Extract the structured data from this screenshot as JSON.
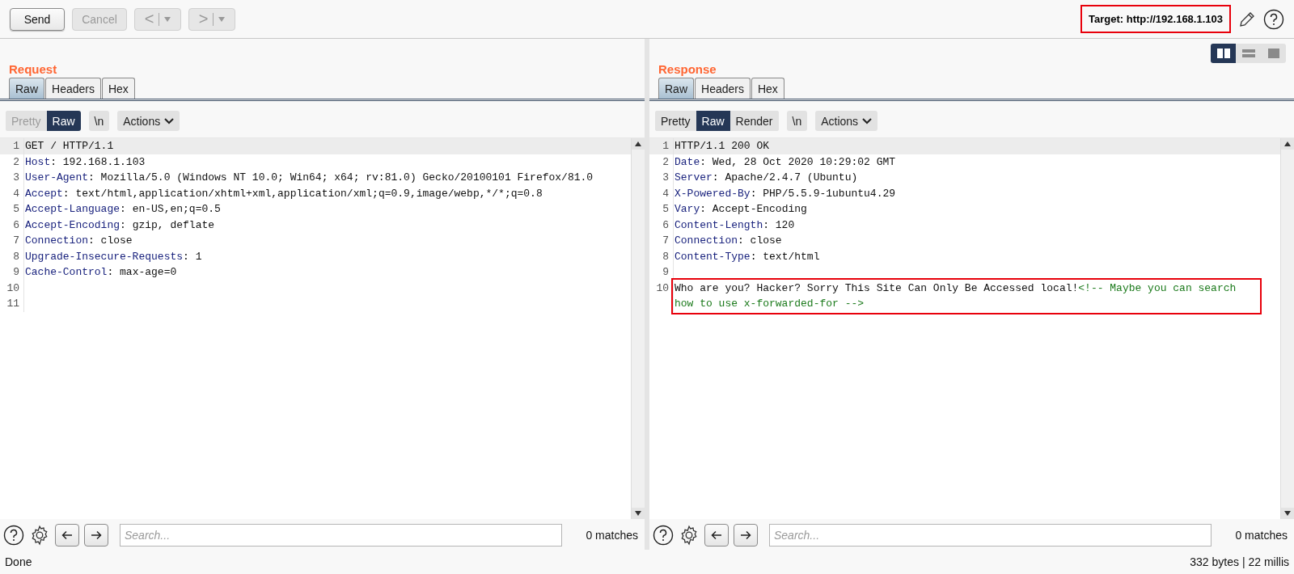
{
  "toolbar": {
    "buttons": [
      {
        "kind": "text",
        "label": "Send",
        "disabled": false
      },
      {
        "kind": "text",
        "label": "Cancel",
        "disabled": true
      },
      {
        "kind": "back",
        "label": "<",
        "disabled": true
      },
      {
        "kind": "forward",
        "label": ">",
        "disabled": true
      }
    ],
    "target": {
      "label": "Target: http://192.168.1.103",
      "outlined": true
    }
  },
  "view_modes": [
    {
      "kind": "split",
      "selected": true
    },
    {
      "kind": "stacked",
      "selected": false
    },
    {
      "kind": "single",
      "selected": false
    }
  ],
  "panes": [
    {
      "title": "Request",
      "tabs": [
        {
          "label": "Raw",
          "selected": true
        },
        {
          "label": "Headers",
          "selected": false
        },
        {
          "label": "Hex",
          "selected": false
        }
      ],
      "formats": [
        {
          "label": "Pretty",
          "selected": false,
          "disabled": true
        },
        {
          "label": "Raw",
          "selected": true,
          "disabled": false
        }
      ],
      "newline": "\\n",
      "actions": "Actions",
      "lines": [
        {
          "number": "1",
          "current": true,
          "outlined": false,
          "segments": [
            {
              "kind": "plain",
              "text": "GET / HTTP/1.1"
            }
          ]
        },
        {
          "number": "2",
          "current": false,
          "outlined": false,
          "segments": [
            {
              "kind": "name",
              "text": "Host"
            },
            {
              "kind": "plain",
              "text": ": 192.168.1.103"
            }
          ]
        },
        {
          "number": "3",
          "current": false,
          "outlined": false,
          "segments": [
            {
              "kind": "name",
              "text": "User-Agent"
            },
            {
              "kind": "plain",
              "text": ": Mozilla/5.0 (Windows NT 10.0; Win64; x64; rv:81.0) Gecko/20100101 Firefox/81.0"
            }
          ]
        },
        {
          "number": "4",
          "current": false,
          "outlined": false,
          "segments": [
            {
              "kind": "name",
              "text": "Accept"
            },
            {
              "kind": "plain",
              "text": ": text/html,application/xhtml+xml,application/xml;q=0.9,image/webp,*/*;q=0.8"
            }
          ]
        },
        {
          "number": "5",
          "current": false,
          "outlined": false,
          "segments": [
            {
              "kind": "name",
              "text": "Accept-Language"
            },
            {
              "kind": "plain",
              "text": ": en-US,en;q=0.5"
            }
          ]
        },
        {
          "number": "6",
          "current": false,
          "outlined": false,
          "segments": [
            {
              "kind": "name",
              "text": "Accept-Encoding"
            },
            {
              "kind": "plain",
              "text": ": gzip, deflate"
            }
          ]
        },
        {
          "number": "7",
          "current": false,
          "outlined": false,
          "segments": [
            {
              "kind": "name",
              "text": "Connection"
            },
            {
              "kind": "plain",
              "text": ": close"
            }
          ]
        },
        {
          "number": "8",
          "current": false,
          "outlined": false,
          "segments": [
            {
              "kind": "name",
              "text": "Upgrade-Insecure-Requests"
            },
            {
              "kind": "plain",
              "text": ": 1"
            }
          ]
        },
        {
          "number": "9",
          "current": false,
          "outlined": false,
          "segments": [
            {
              "kind": "name",
              "text": "Cache-Control"
            },
            {
              "kind": "plain",
              "text": ": max-age=0"
            }
          ]
        },
        {
          "number": "10",
          "current": false,
          "outlined": false
        },
        {
          "number": "11",
          "current": false,
          "outlined": false
        }
      ],
      "search": {
        "placeholder": "Search...",
        "matches": "0 matches"
      }
    },
    {
      "title": "Response",
      "tabs": [
        {
          "label": "Raw",
          "selected": true
        },
        {
          "label": "Headers",
          "selected": false
        },
        {
          "label": "Hex",
          "selected": false
        }
      ],
      "formats": [
        {
          "label": "Pretty",
          "selected": false,
          "disabled": false
        },
        {
          "label": "Raw",
          "selected": true,
          "disabled": false
        },
        {
          "label": "Render",
          "selected": false,
          "disabled": false
        }
      ],
      "newline": "\\n",
      "actions": "Actions",
      "lines": [
        {
          "number": "1",
          "current": true,
          "outlined": false,
          "segments": [
            {
              "kind": "plain",
              "text": "HTTP/1.1 200 OK"
            }
          ]
        },
        {
          "number": "2",
          "current": false,
          "outlined": false,
          "segments": [
            {
              "kind": "name",
              "text": "Date"
            },
            {
              "kind": "plain",
              "text": ": Wed, 28 Oct 2020 10:29:02 GMT"
            }
          ]
        },
        {
          "number": "3",
          "current": false,
          "outlined": false,
          "segments": [
            {
              "kind": "name",
              "text": "Server"
            },
            {
              "kind": "plain",
              "text": ": Apache/2.4.7 (Ubuntu)"
            }
          ]
        },
        {
          "number": "4",
          "current": false,
          "outlined": false,
          "segments": [
            {
              "kind": "name",
              "text": "X-Powered-By"
            },
            {
              "kind": "plain",
              "text": ": PHP/5.5.9-1ubuntu4.29"
            }
          ]
        },
        {
          "number": "5",
          "current": false,
          "outlined": false,
          "segments": [
            {
              "kind": "name",
              "text": "Vary"
            },
            {
              "kind": "plain",
              "text": ": Accept-Encoding"
            }
          ]
        },
        {
          "number": "6",
          "current": false,
          "outlined": false,
          "segments": [
            {
              "kind": "name",
              "text": "Content-Length"
            },
            {
              "kind": "plain",
              "text": ": 120"
            }
          ]
        },
        {
          "number": "7",
          "current": false,
          "outlined": false,
          "segments": [
            {
              "kind": "name",
              "text": "Connection"
            },
            {
              "kind": "plain",
              "text": ": close"
            }
          ]
        },
        {
          "number": "8",
          "current": false,
          "outlined": false,
          "segments": [
            {
              "kind": "name",
              "text": "Content-Type"
            },
            {
              "kind": "plain",
              "text": ": text/html"
            }
          ]
        },
        {
          "number": "9",
          "current": false,
          "outlined": false
        },
        {
          "number": "10",
          "current": false,
          "outlined": true,
          "segments": [
            {
              "kind": "plain",
              "text": "Who are you? Hacker? Sorry This Site Can Only Be Accessed local!"
            },
            {
              "kind": "comment",
              "text": "<!-- Maybe you can search how to use x-forwarded-for -->"
            }
          ]
        }
      ],
      "search": {
        "placeholder": "Search...",
        "matches": "0 matches"
      }
    }
  ],
  "status_bar": {
    "left": "Done",
    "right": "332 bytes | 22 millis"
  }
}
